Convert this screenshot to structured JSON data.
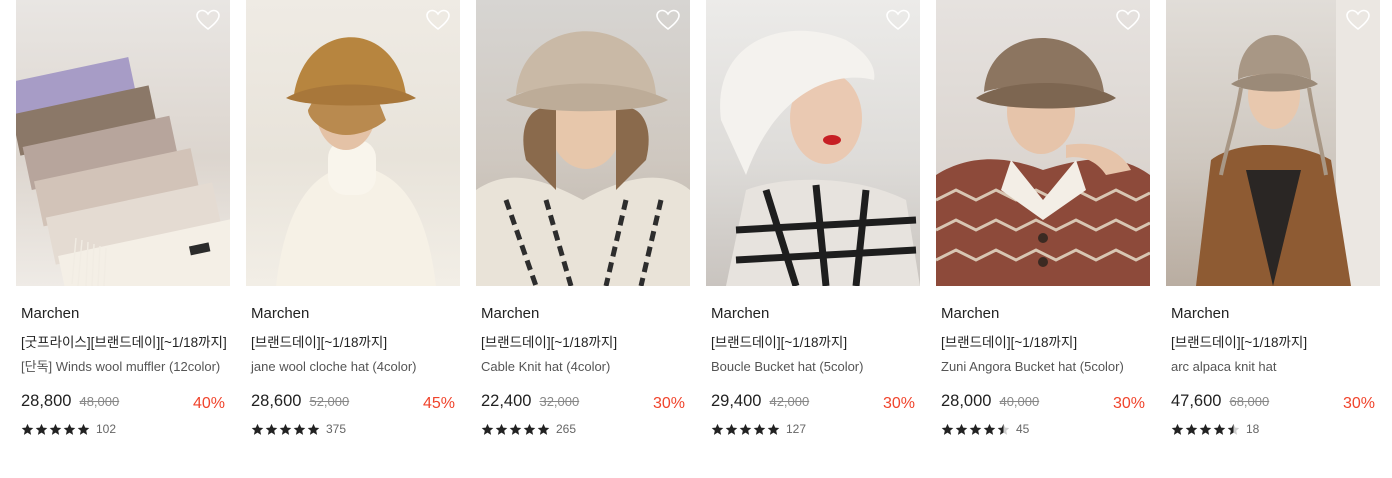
{
  "products": [
    {
      "brand": "Marchen",
      "promo": "[굿프라이스][브랜드데이][~1/18까지]",
      "name": "[단독] Winds wool muffler (12color)",
      "price": "28,800",
      "original_price": "48,000",
      "discount": "40%",
      "rating_stars": 5,
      "review_count": "102",
      "image": "stacked folded wool mufflers",
      "bg": [
        "#e9e6e3",
        "#d9d2cb",
        "#efebe6"
      ]
    },
    {
      "brand": "Marchen",
      "promo": "[브랜드데이][~1/18까지]",
      "name": "jane wool cloche hat (4color)",
      "price": "28,600",
      "original_price": "52,000",
      "discount": "45%",
      "rating_stars": 5,
      "review_count": "375",
      "image": "woman in camel cloche hat and white turtleneck",
      "bg": [
        "#efebe4",
        "#e8e3da",
        "#f2eee6"
      ]
    },
    {
      "brand": "Marchen",
      "promo": "[브랜드데이][~1/18까지]",
      "name": "Cable Knit hat (4color)",
      "price": "22,400",
      "original_price": "32,000",
      "discount": "30%",
      "rating_stars": 5,
      "review_count": "265",
      "image": "woman in beige cable knit hat",
      "bg": [
        "#d7d5d2",
        "#cfc8c0",
        "#bdb4aa"
      ]
    },
    {
      "brand": "Marchen",
      "promo": "[브랜드데이][~1/18까지]",
      "name": "Boucle Bucket hat (5color)",
      "price": "29,400",
      "original_price": "42,000",
      "discount": "30%",
      "rating_stars": 5,
      "review_count": "127",
      "image": "woman in white boucle bucket hat and plaid coat",
      "bg": [
        "#ecebe9",
        "#dedcd9",
        "#c9c4bf"
      ]
    },
    {
      "brand": "Marchen",
      "promo": "[브랜드데이][~1/18까지]",
      "name": "Zuni Angora Bucket hat (5color)",
      "price": "28,000",
      "original_price": "40,000",
      "discount": "30%",
      "rating_stars": 4.5,
      "review_count": "45",
      "image": "woman in brown angora bucket hat and patterned cardigan",
      "bg": [
        "#e6e2df",
        "#dcd6d1",
        "#cfc6bf"
      ]
    },
    {
      "brand": "Marchen",
      "promo": "[브랜드데이][~1/18까지]",
      "name": "arc alpaca knit hat",
      "price": "47,600",
      "original_price": "68,000",
      "discount": "30%",
      "rating_stars": 4.5,
      "review_count": "18",
      "image": "woman in alpaca knit hat with ear ties and brown coat",
      "bg": [
        "#e1ddd8",
        "#cfc8c0",
        "#b9ada1"
      ]
    }
  ],
  "colors": {
    "discount": "#f0442c",
    "star": "#222222"
  }
}
